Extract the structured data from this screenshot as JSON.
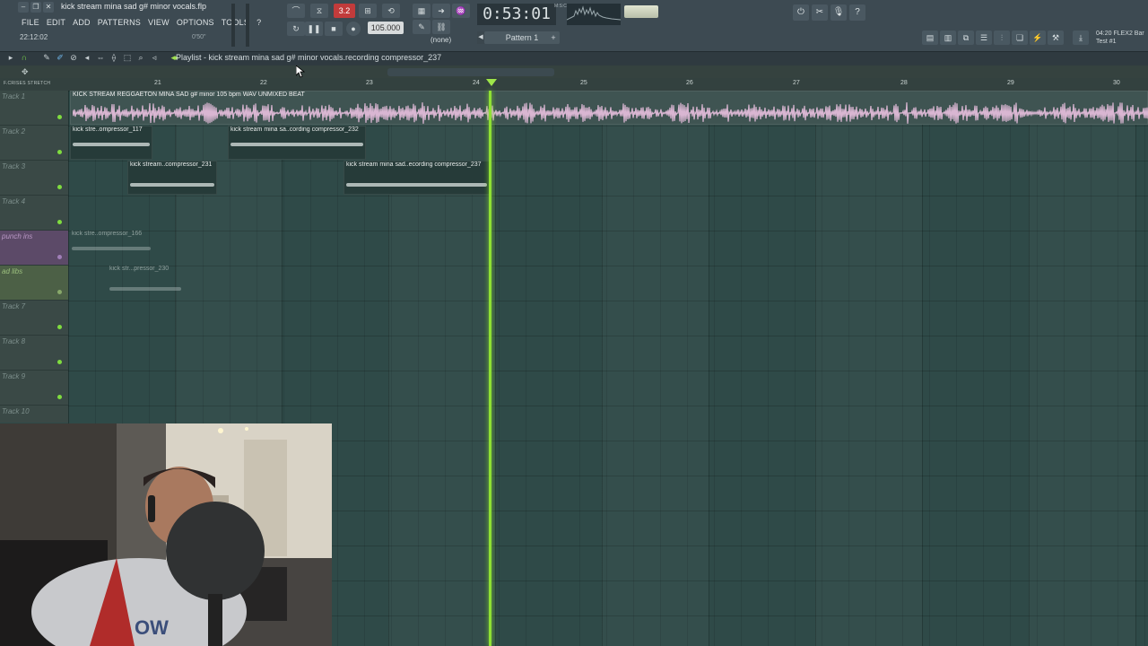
{
  "window": {
    "file_title": "kick stream mina sad g# minor vocals.flp",
    "menu": [
      "FILE",
      "EDIT",
      "ADD",
      "PATTERNS",
      "VIEW",
      "OPTIONS",
      "TOOLS",
      "?"
    ],
    "hint_left": "22:12:02",
    "hint_right": "0'50\""
  },
  "transport": {
    "time": "0:53:01",
    "time_unit": "M:S:CS",
    "tempo": "105.000",
    "pattern": "Pattern 1",
    "snap": "(none)",
    "rec_indicator": "3.2"
  },
  "plugin": {
    "line1": "04:20  FLEX2 Bar",
    "line2": "Test #1"
  },
  "playlist": {
    "title": "Playlist - kick stream mina sad g# minor vocals.recording compressor_237",
    "ruler_left": "F.CRISES  STRETCH",
    "ruler_numbers": [
      "21",
      "22",
      "23",
      "24",
      "25",
      "26",
      "27",
      "28",
      "29",
      "30"
    ]
  },
  "tracks": [
    {
      "label": "Track 1"
    },
    {
      "label": "Track 2"
    },
    {
      "label": "Track 3"
    },
    {
      "label": "Track 4"
    },
    {
      "label": "punch ins"
    },
    {
      "label": "ad libs"
    },
    {
      "label": "Track 7"
    },
    {
      "label": "Track 8"
    },
    {
      "label": "Track 9"
    },
    {
      "label": "Track 10"
    }
  ],
  "clips": [
    {
      "title": "KICK STREAM REGGAETON MINA SAD g# minor 105 bpm WAV UNMIXED BEAT"
    },
    {
      "title": "kick stre..ompressor_117"
    },
    {
      "title": "kick stream mina sa..cording compressor_232"
    },
    {
      "title": "kick stream..compressor_231"
    },
    {
      "title": "kick stream mina sad..ecording compressor_237"
    },
    {
      "title": "kick stre..ompressor_166"
    },
    {
      "title": "kick str...pressor_230"
    }
  ]
}
